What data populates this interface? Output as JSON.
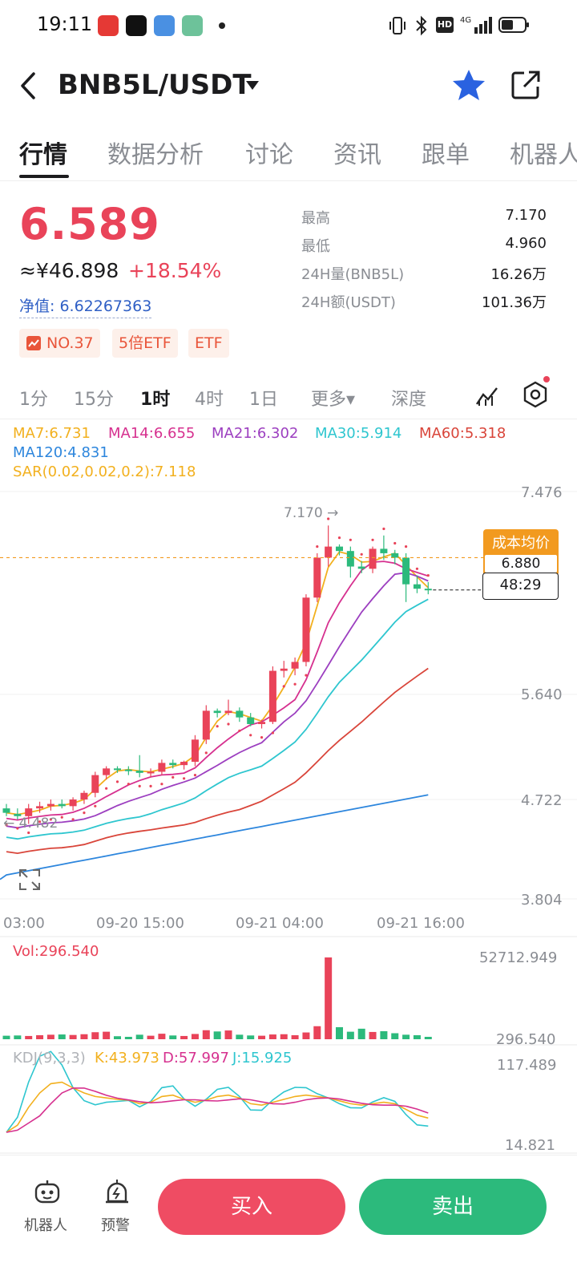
{
  "status_bar": {
    "time": "19:11"
  },
  "header": {
    "pair": "BNB5L/USDT"
  },
  "tabs": [
    "行情",
    "数据分析",
    "讨论",
    "资讯",
    "跟单",
    "机器人"
  ],
  "price": {
    "last": "6.589",
    "cny": "≈¥46.898",
    "change": "+18.54%",
    "nav": "净值: 6.62267363",
    "badges": [
      "NO.37",
      "5倍ETF",
      "ETF"
    ]
  },
  "stats": [
    {
      "label": "最高",
      "value": "7.170"
    },
    {
      "label": "最低",
      "value": "4.960"
    },
    {
      "label": "24H量(BNB5L)",
      "value": "16.26万"
    },
    {
      "label": "24H额(USDT)",
      "value": "101.36万"
    }
  ],
  "intervals": [
    "1分",
    "15分",
    "1时",
    "4时",
    "1日",
    "更多▾",
    "深度"
  ],
  "active_interval": "1时",
  "ma": {
    "ma7": "MA7:6.731",
    "ma14": "MA14:6.655",
    "ma21": "MA21:6.302",
    "ma30": "MA30:5.914",
    "ma60": "MA60:5.318",
    "ma120": "MA120:4.831",
    "sar": "SAR(0.02,0.02,0.2):7.118"
  },
  "colors": {
    "up": "#e94359",
    "down": "#2cba7c",
    "ma7": "#f2b01e",
    "ma14": "#d6308f",
    "ma21": "#9c3fc0",
    "ma30": "#2ec6cf",
    "ma60": "#d9453a",
    "ma120": "#2d86dd",
    "sar": "#e94359"
  },
  "chart_labels": {
    "high_marker": "7.170 →",
    "low_marker": "← 4.482",
    "cost_label": "成本均价",
    "cost_value": "6.880",
    "countdown": "48:29"
  },
  "chart_data": {
    "type": "candlestick",
    "y_ticks": [
      "7.476",
      "5.640",
      "4.722",
      "3.804"
    ],
    "x_ticks": [
      "03:00",
      "09-20 15:00",
      "09-21 04:00",
      "09-21 16:00"
    ],
    "high": 7.17,
    "low": 4.482,
    "candles": [
      {
        "o": 4.62,
        "h": 4.66,
        "l": 4.55,
        "c": 4.58
      },
      {
        "o": 4.57,
        "h": 4.62,
        "l": 4.52,
        "c": 4.55
      },
      {
        "o": 4.55,
        "h": 4.66,
        "l": 4.48,
        "c": 4.62
      },
      {
        "o": 4.62,
        "h": 4.68,
        "l": 4.58,
        "c": 4.64
      },
      {
        "o": 4.64,
        "h": 4.7,
        "l": 4.6,
        "c": 4.66
      },
      {
        "o": 4.66,
        "h": 4.7,
        "l": 4.62,
        "c": 4.64
      },
      {
        "o": 4.64,
        "h": 4.72,
        "l": 4.6,
        "c": 4.7
      },
      {
        "o": 4.7,
        "h": 4.78,
        "l": 4.66,
        "c": 4.76
      },
      {
        "o": 4.76,
        "h": 4.95,
        "l": 4.72,
        "c": 4.92
      },
      {
        "o": 4.92,
        "h": 5.0,
        "l": 4.88,
        "c": 4.98
      },
      {
        "o": 4.98,
        "h": 5.0,
        "l": 4.94,
        "c": 4.97
      },
      {
        "o": 4.97,
        "h": 5.0,
        "l": 4.92,
        "c": 4.96
      },
      {
        "o": 4.96,
        "h": 5.1,
        "l": 4.9,
        "c": 4.94
      },
      {
        "o": 4.94,
        "h": 4.98,
        "l": 4.9,
        "c": 4.95
      },
      {
        "o": 4.95,
        "h": 5.06,
        "l": 4.92,
        "c": 5.03
      },
      {
        "o": 5.03,
        "h": 5.06,
        "l": 4.98,
        "c": 5.01
      },
      {
        "o": 5.01,
        "h": 5.05,
        "l": 4.97,
        "c": 5.04
      },
      {
        "o": 5.04,
        "h": 5.28,
        "l": 5.0,
        "c": 5.24
      },
      {
        "o": 5.24,
        "h": 5.55,
        "l": 5.2,
        "c": 5.5
      },
      {
        "o": 5.5,
        "h": 5.52,
        "l": 5.44,
        "c": 5.48
      },
      {
        "o": 5.48,
        "h": 5.6,
        "l": 5.46,
        "c": 5.5
      },
      {
        "o": 5.5,
        "h": 5.53,
        "l": 5.4,
        "c": 5.44
      },
      {
        "o": 5.44,
        "h": 5.48,
        "l": 5.36,
        "c": 5.38
      },
      {
        "o": 5.38,
        "h": 5.42,
        "l": 5.34,
        "c": 5.4
      },
      {
        "o": 5.4,
        "h": 5.9,
        "l": 5.38,
        "c": 5.86
      },
      {
        "o": 5.86,
        "h": 5.95,
        "l": 5.8,
        "c": 5.88
      },
      {
        "o": 5.88,
        "h": 5.98,
        "l": 5.82,
        "c": 5.94
      },
      {
        "o": 5.94,
        "h": 6.55,
        "l": 5.9,
        "c": 6.52
      },
      {
        "o": 6.52,
        "h": 6.92,
        "l": 6.48,
        "c": 6.88
      },
      {
        "o": 6.88,
        "h": 7.17,
        "l": 6.8,
        "c": 6.98
      },
      {
        "o": 6.98,
        "h": 7.0,
        "l": 6.9,
        "c": 6.94
      },
      {
        "o": 6.94,
        "h": 6.98,
        "l": 6.7,
        "c": 6.8
      },
      {
        "o": 6.8,
        "h": 6.85,
        "l": 6.74,
        "c": 6.78
      },
      {
        "o": 6.78,
        "h": 6.98,
        "l": 6.74,
        "c": 6.96
      },
      {
        "o": 6.96,
        "h": 7.08,
        "l": 6.86,
        "c": 6.92
      },
      {
        "o": 6.92,
        "h": 6.95,
        "l": 6.82,
        "c": 6.88
      },
      {
        "o": 6.88,
        "h": 6.92,
        "l": 6.48,
        "c": 6.64
      },
      {
        "o": 6.64,
        "h": 6.72,
        "l": 6.56,
        "c": 6.6
      },
      {
        "o": 6.6,
        "h": 6.66,
        "l": 6.55,
        "c": 6.589
      }
    ],
    "volume": {
      "label": "Vol:296.540",
      "ticks": [
        "52712.949",
        "296.540"
      ],
      "values": [
        1400,
        1500,
        1300,
        1600,
        1800,
        1900,
        1700,
        2000,
        2800,
        3000,
        1200,
        900,
        1800,
        1400,
        2200,
        1500,
        1300,
        2100,
        3600,
        3100,
        3500,
        1800,
        1500,
        1400,
        1900,
        2000,
        1600,
        2700,
        5200,
        52712,
        4800,
        3000,
        4200,
        2900,
        3200,
        2400,
        1800,
        1600,
        296.54
      ]
    },
    "kdj": {
      "label": "KDJ(9,3,3)",
      "k": "K:43.973",
      "d": "D:57.997",
      "j": "J:15.925",
      "ticks": [
        "117.489",
        "14.821"
      ]
    }
  },
  "bottom_bar": {
    "robot": "机器人",
    "alert": "预警",
    "buy": "买入",
    "sell": "卖出"
  }
}
